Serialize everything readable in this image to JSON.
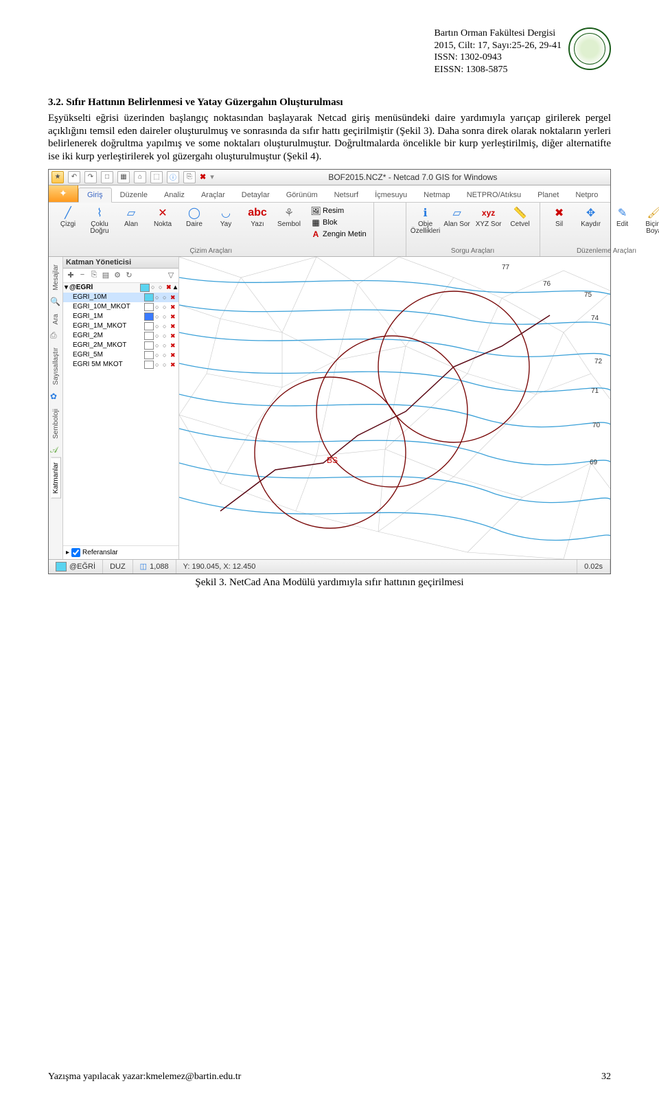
{
  "header": {
    "line1": "Bartın Orman Fakültesi Dergisi",
    "line2": "2015, Cilt: 17, Sayı:25-26, 29-41",
    "line3": "ISSN: 1302-0943",
    "line4": "EISSN: 1308-5875"
  },
  "section_heading": "3.2. Sıfır Hattının Belirlenmesi ve Yatay Güzergahın Oluşturulması",
  "paragraph": "Eşyükselti eğrisi üzerinden başlangıç noktasından başlayarak Netcad giriş menüsündeki daire yardımıyla yarıçap girilerek pergel açıklığını temsil eden daireler oluşturulmuş ve sonrasında da sıfır hattı geçirilmiştir (Şekil 3). Daha sonra direk olarak noktaların yerleri belirlenerek doğrultma yapılmış ve some noktaları oluşturulmuştur. Doğrultmalarda öncelikle bir kurp yerleştirilmiş, diğer alternatifte ise iki kurp yerleştirilerek yol güzergahı oluşturulmuştur (Şekil 4).",
  "app": {
    "title": "BOF2015.NCZ* - Netcad 7.0 GIS for Windows",
    "tabs": [
      "Giriş",
      "Düzenle",
      "Analiz",
      "Araçlar",
      "Detaylar",
      "Görünüm",
      "Netsurf",
      "İçmesuyu",
      "Netmap",
      "NETPRO/Atıksu",
      "Planet",
      "Netpro"
    ],
    "active_tab": "Giriş",
    "group1": {
      "items": [
        "Çizgi",
        "Çoklu Doğru",
        "Alan",
        "Nokta",
        "Daire",
        "Yay",
        "Yazı",
        "Sembol"
      ],
      "extra": [
        "Resim",
        "Blok",
        "Zengin Metin"
      ],
      "title": "Çizim Araçları",
      "abc": "abc",
      "A": "A"
    },
    "group2": {
      "items": [
        "Obje Özellikleri",
        "Alan Sor",
        "XYZ Sor",
        "Cetvel"
      ],
      "xyz": "xyz",
      "title": "Sorgu Araçları"
    },
    "group3": {
      "items": [
        "Sil",
        "Kaydır",
        "Edit",
        "Biçim Boya"
      ],
      "title": "Düzenleme Araçları"
    },
    "panel_title": "Katman Yöneticisi",
    "layer_header": "@EĞRİ",
    "layers": [
      {
        "name": "EĞRİ_10M",
        "color": "#5bd4f0",
        "sel": true
      },
      {
        "name": "EĞRİ_10M_MKOT",
        "color": "#ffffff"
      },
      {
        "name": "EĞRİ_1M",
        "color": "#3a7bff"
      },
      {
        "name": "EĞRİ_1M_MKOT",
        "color": "#ffffff"
      },
      {
        "name": "EĞRİ_2M",
        "color": "#ffffff"
      },
      {
        "name": "EĞRİ_2M_MKOT",
        "color": "#ffffff"
      },
      {
        "name": "EĞRİ_5M",
        "color": "#ffffff"
      },
      {
        "name": "EĞRİ 5M MKOT",
        "color": "#ffffff"
      }
    ],
    "refs": "Referanslar",
    "vtabs": [
      "Mesajlar",
      "Ara",
      "Sayısallaştır",
      "Semboloji",
      "Katmanlar"
    ],
    "contour_labels": [
      "77",
      "76",
      "75",
      "74",
      "72",
      "71",
      "70",
      "69"
    ],
    "bs_label": "BS",
    "status": {
      "layer": "@EĞRİ",
      "mode": "DUZ",
      "objs_icon": "◫",
      "objs": "1,088",
      "coords": "Y: 190.045, X: 12.450",
      "time": "0.02s"
    }
  },
  "caption": "Şekil 3. NetCad Ana Modülü yardımıyla sıfır hattının geçirilmesi",
  "footer_left": "Yazışma yapılacak yazar:kmelemez@bartin.edu.tr",
  "footer_right": "32"
}
